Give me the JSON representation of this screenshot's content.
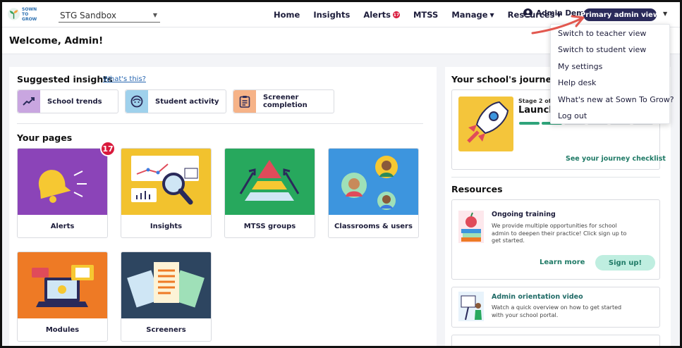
{
  "logo": {
    "line1": "SOWN",
    "line2": "TO GROW"
  },
  "header": {
    "org_select": "STG Sandbox",
    "nav": [
      {
        "label": "Home"
      },
      {
        "label": "Insights"
      },
      {
        "label": "Alerts",
        "badge": "17"
      },
      {
        "label": "MTSS"
      },
      {
        "label": "Manage"
      },
      {
        "label": "Resources"
      }
    ],
    "user_name": "Admin Demo",
    "role_view": "Primary admin view"
  },
  "welcome": {
    "title": "Welcome, Admin!"
  },
  "insights": {
    "title": "Suggested insights",
    "whats_this": "What's this?",
    "cards": [
      {
        "label": "School trends",
        "icon": "trend-up-icon",
        "color": "#c9a6e0"
      },
      {
        "label": "Student activity",
        "icon": "face-icon",
        "color": "#9fd1ec"
      },
      {
        "label": "Screener completion",
        "label_line1": "Screener",
        "label_line2": "completion",
        "icon": "clipboard-icon",
        "color": "#f6b388"
      }
    ]
  },
  "pages": {
    "title": "Your pages",
    "alerts_badge": "17",
    "cards": [
      {
        "label": "Alerts",
        "color": "#8b44b8"
      },
      {
        "label": "Insights",
        "color": "#f2c22e"
      },
      {
        "label": "MTSS groups",
        "color": "#27a85d"
      },
      {
        "label": "Classrooms & users",
        "color": "#3d95de"
      },
      {
        "label": "Modules",
        "color": "#ee7a25"
      },
      {
        "label": "Screeners",
        "color": "#2d4560"
      }
    ]
  },
  "journey": {
    "title": "Your school's journey",
    "stage": "Stage 2 of",
    "name": "Launch",
    "progress_steps_done": 2,
    "progress_steps_total": 6,
    "link": "See your journey checklist"
  },
  "resources": {
    "title": "Resources",
    "items": [
      {
        "title": "Ongoing training",
        "desc": "We provide multiple opportunities for school admin to deepen their practice! Click sign up to get started.",
        "learn_more": "Learn more",
        "signup": "Sign up!"
      },
      {
        "title": "Admin orientation video",
        "desc": "Watch a quick overview on how to get started with your school portal."
      }
    ]
  },
  "dropdown": {
    "items": [
      "Switch to teacher view",
      "Switch to student view",
      "My settings",
      "Help desk",
      "What's new at Sown To Grow?",
      "Log out"
    ]
  },
  "colors": {
    "accent_dark": "#2a2a5a",
    "alert_red": "#d91a3c",
    "link_green": "#1f7a66"
  }
}
